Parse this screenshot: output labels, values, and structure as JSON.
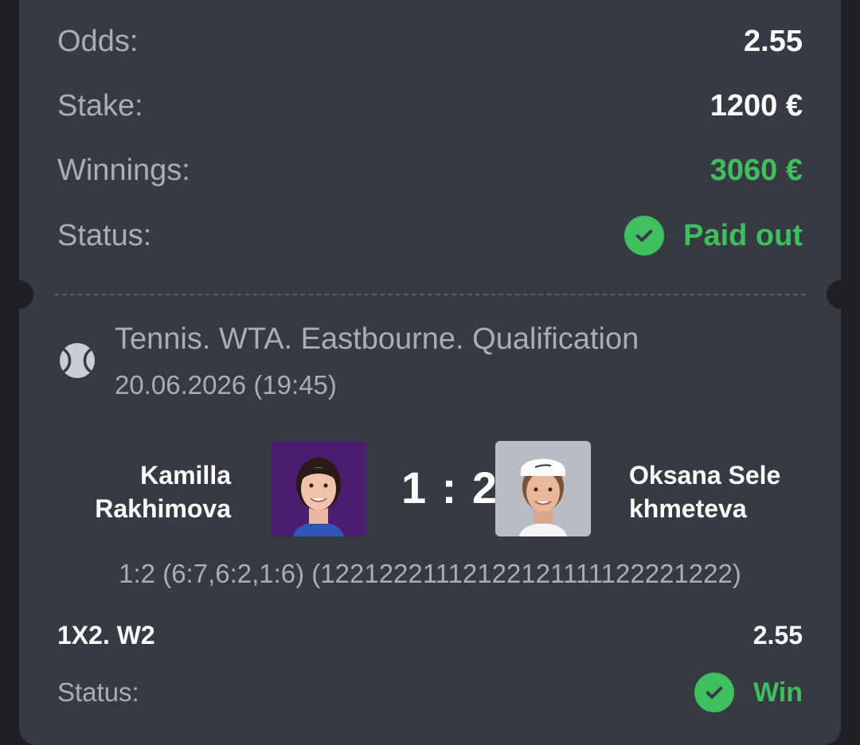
{
  "summary": {
    "odds_label": "Odds:",
    "odds_value": "2.55",
    "stake_label": "Stake:",
    "stake_value": "1200 €",
    "winnings_label": "Winnings:",
    "winnings_value": "3060 €",
    "status_label": "Status:",
    "status_value": "Paid out"
  },
  "event": {
    "title": "Tennis. WTA. Eastbourne. Qualification",
    "datetime": "20.06.2026 (19:45)",
    "player1_line1": "Kamilla",
    "player1_line2": "Rakhimova",
    "player2_line1": "Oksana Sele",
    "player2_line2": "khmeteva",
    "score": "1 : 2",
    "details": "1:2 (6:7,6:2,1:6) (12212221112122121111122221222)",
    "sport_icon": "tennis-ball-icon"
  },
  "selection": {
    "market": "1X2. W2",
    "odds": "2.55",
    "status_label": "Status:",
    "status_value": "Win"
  },
  "colors": {
    "card": "#363a42",
    "background": "#1f2024",
    "accent_green": "#3fbf5e",
    "muted_text": "#a9adb5"
  }
}
